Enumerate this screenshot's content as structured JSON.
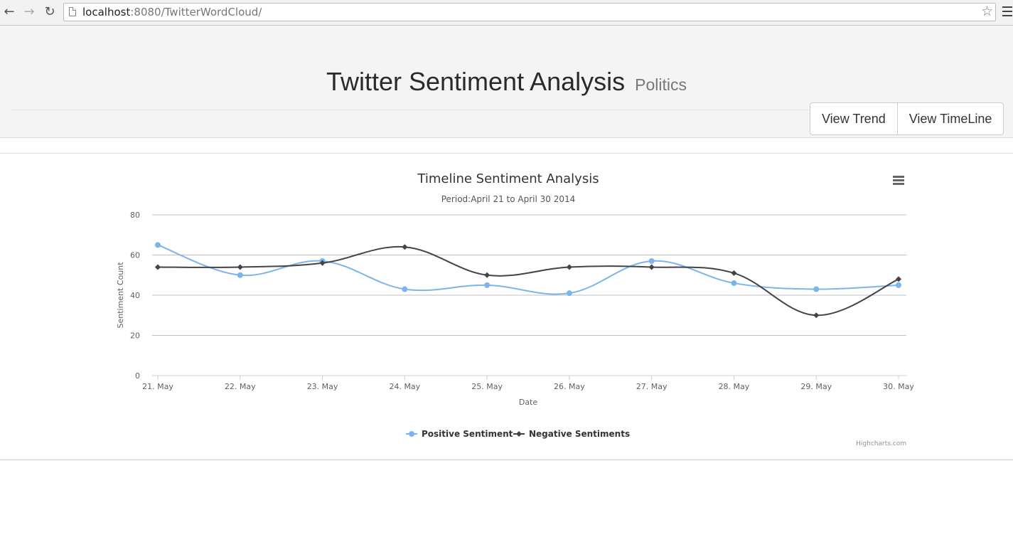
{
  "browser": {
    "url_host": "localhost",
    "url_rest": ":8080/TwitterWordCloud/"
  },
  "header": {
    "title": "Twitter Sentiment Analysis",
    "subtitle": "Politics",
    "buttons": [
      "View Trend",
      "View TimeLine"
    ]
  },
  "credit": "Highcharts.com",
  "colors": {
    "positive": "#7cb5ec",
    "negative": "#434348"
  },
  "chart_data": {
    "type": "line",
    "title": "Timeline Sentiment Analysis",
    "subtitle": "Period:April 21 to April 30 2014",
    "xlabel": "Date",
    "ylabel": "Sentiment Count",
    "categories": [
      "21. May",
      "22. May",
      "23. May",
      "24. May",
      "25. May",
      "26. May",
      "27. May",
      "28. May",
      "29. May",
      "30. May"
    ],
    "ylim": [
      0,
      80
    ],
    "yticks": [
      0,
      20,
      40,
      60,
      80
    ],
    "grid": true,
    "legend_position": "bottom-center",
    "series": [
      {
        "name": "Positive Sentiment",
        "marker": "circle",
        "values": [
          65,
          50,
          57,
          43,
          45,
          41,
          57,
          46,
          43,
          45
        ]
      },
      {
        "name": "Negative Sentiments",
        "marker": "diamond",
        "values": [
          54,
          54,
          56,
          64,
          50,
          54,
          54,
          51,
          30,
          48
        ]
      }
    ]
  }
}
